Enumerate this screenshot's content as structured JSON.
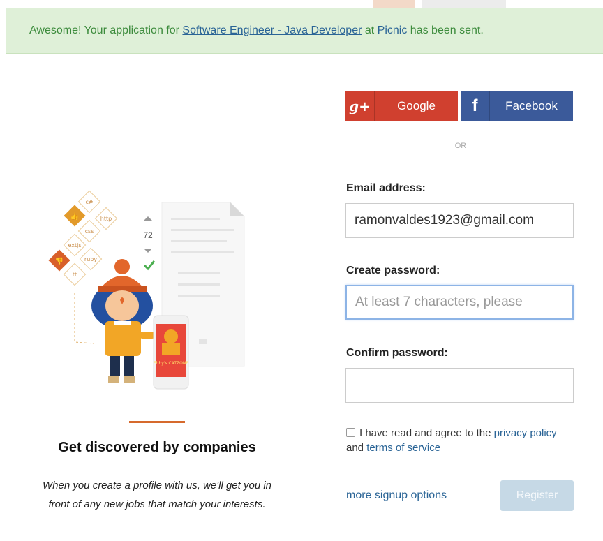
{
  "banner": {
    "prefix": "Awesome! Your application for ",
    "job_link": "Software Engineer - Java Developer",
    "middle": " at ",
    "company_link": "Picnic",
    "suffix": " has been sent."
  },
  "left": {
    "title": "Get discovered by companies",
    "description": "When you create a profile with us, we'll get you in front of any new jobs that match your interests.",
    "illustration": {
      "tags": [
        "c#",
        "http",
        "css",
        "extjs",
        "ruby",
        "tt"
      ],
      "vote_count": "72",
      "phone_title": "Ebby's CATZONE"
    }
  },
  "social": {
    "google": {
      "icon": "g+",
      "label": "Google"
    },
    "facebook": {
      "icon": "f",
      "label": "Facebook"
    }
  },
  "or_label": "OR",
  "form": {
    "email_label": "Email address:",
    "email_value": "ramonvaldes1923@gmail.com",
    "password_label": "Create password:",
    "password_placeholder": "At least 7 characters, please",
    "confirm_label": "Confirm password:",
    "confirm_value": "",
    "agree_prefix": "I have read and agree to the ",
    "privacy_link": "privacy policy",
    "agree_middle": " and ",
    "terms_link": "terms of service",
    "more_options": "more signup options",
    "register_button": "Register"
  },
  "colors": {
    "banner_bg": "#dff0d8",
    "google": "#d0402f",
    "facebook": "#3b5a9a",
    "link": "#2a6496",
    "accent": "#d66a2d",
    "register_disabled": "#c6d9e6"
  }
}
